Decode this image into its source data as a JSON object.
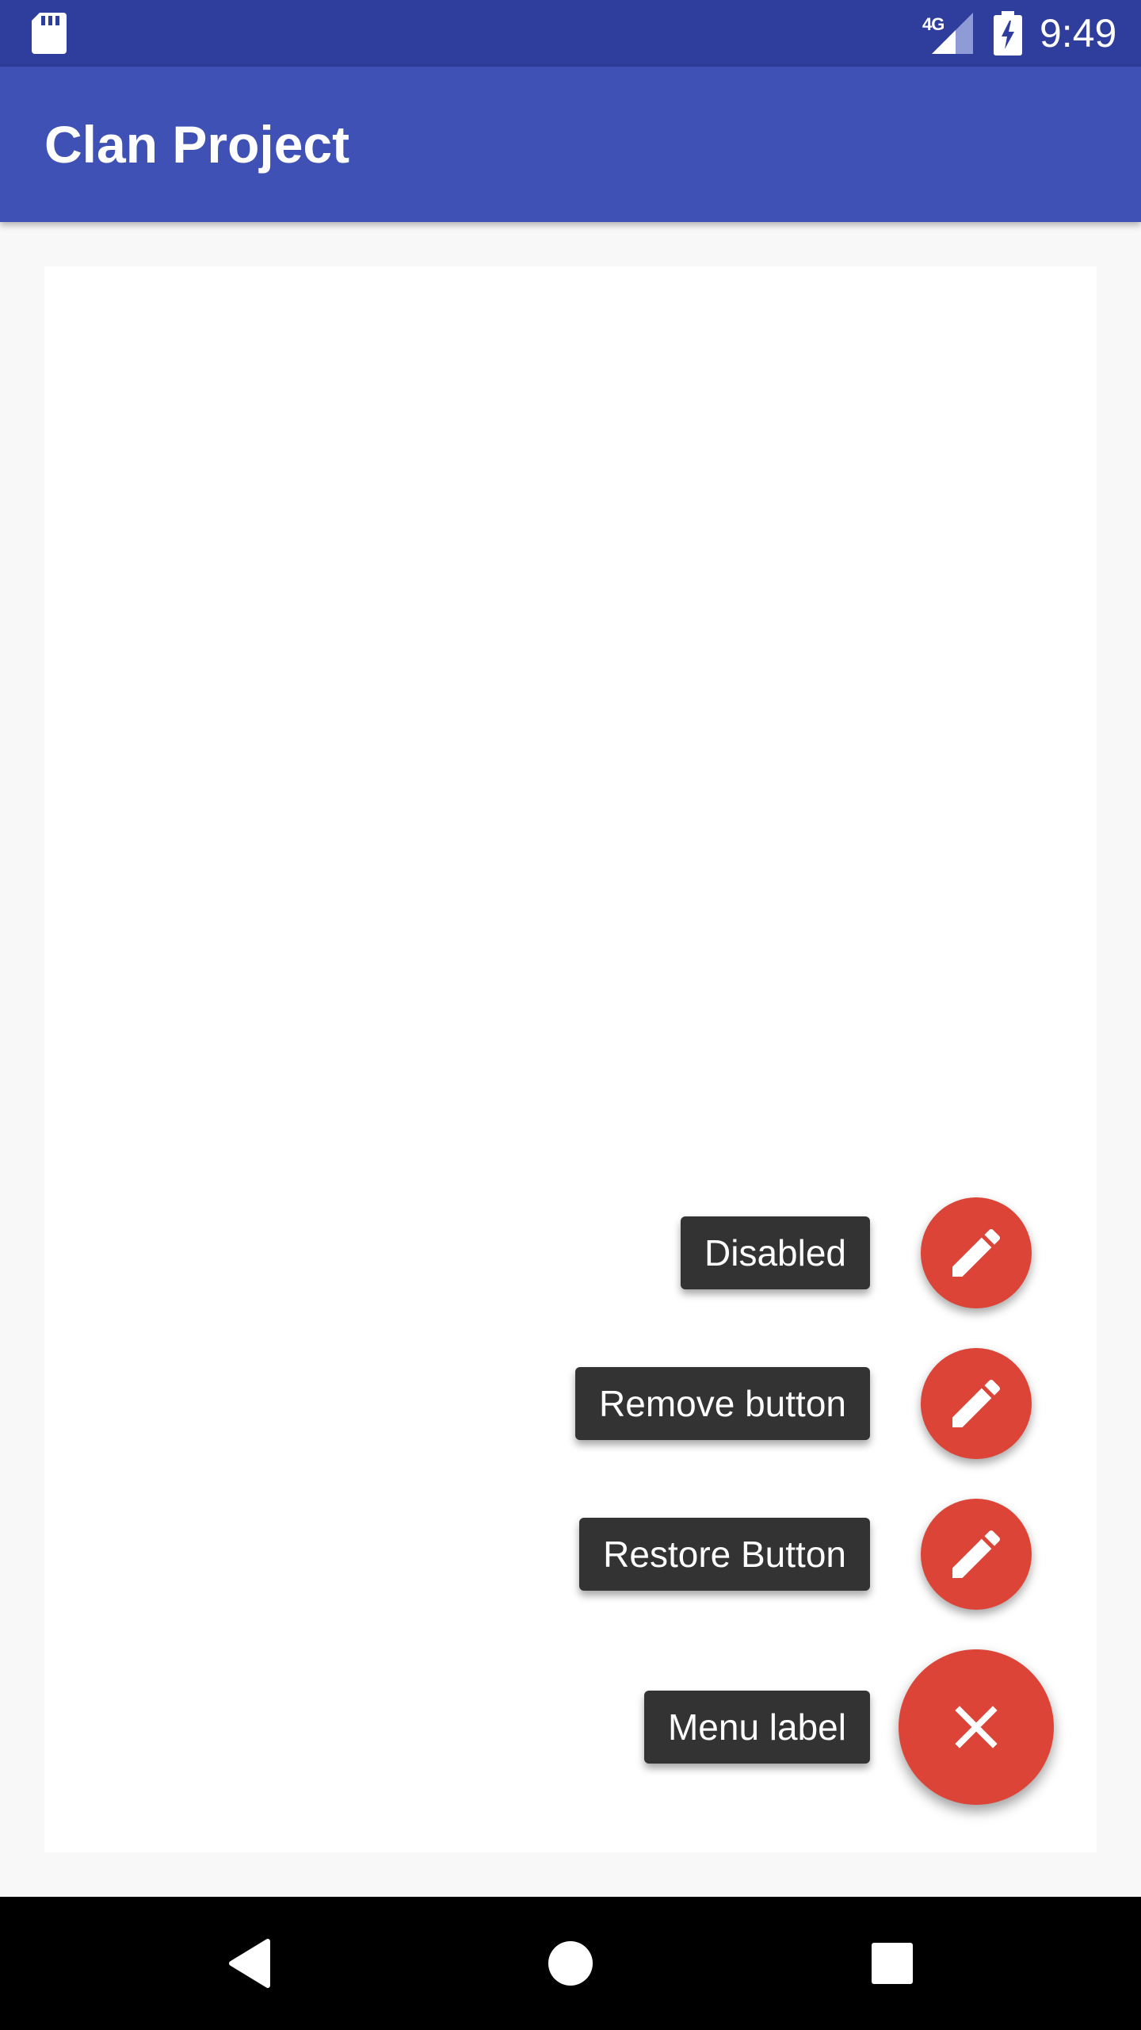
{
  "status_bar": {
    "network": "4G",
    "time": "9:49",
    "icons": [
      "sd-card-icon",
      "signal-icon",
      "battery-charging-icon"
    ]
  },
  "app_bar": {
    "title": "Clan Project"
  },
  "fab_menu": {
    "items": [
      {
        "label": "Disabled",
        "icon": "pencil-icon"
      },
      {
        "label": "Remove button",
        "icon": "pencil-icon"
      },
      {
        "label": "Restore Button",
        "icon": "pencil-icon"
      }
    ],
    "menu_label": "Menu label",
    "menu_icon": "close-icon"
  },
  "nav_bar": {
    "buttons": [
      "back-icon",
      "home-icon",
      "recents-icon"
    ]
  },
  "colors": {
    "status_bar": "#2f3d9c",
    "app_bar": "#3f51b5",
    "fab": "#db4437",
    "label_bg": "#333333",
    "background": "#f8f8f8"
  }
}
